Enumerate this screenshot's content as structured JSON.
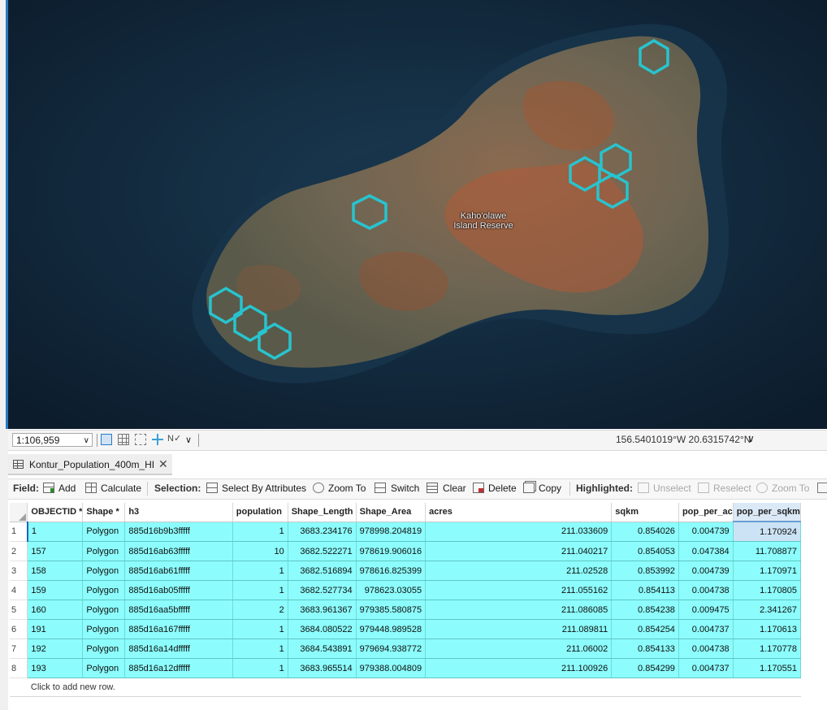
{
  "map": {
    "place_label_line1": "Kaho'olawe",
    "place_label_line2": "Island Reserve"
  },
  "statusbar": {
    "scale": "1:106,959",
    "coordinates": "156.5401019°W 20.6315742°N"
  },
  "tab": {
    "title": "Kontur_Population_400m_HI",
    "close_glyph": "✕"
  },
  "toolbar": {
    "field_label": "Field:",
    "add": "Add",
    "calculate": "Calculate",
    "selection_label": "Selection:",
    "select_by_attributes": "Select By Attributes",
    "zoom_to": "Zoom To",
    "switch": "Switch",
    "clear": "Clear",
    "delete": "Delete",
    "copy": "Copy",
    "highlighted_label": "Highlighted:",
    "unselect": "Unselect",
    "reselect": "Reselect",
    "zoom_to_2": "Zoom To"
  },
  "table": {
    "columns": [
      "OBJECTID *",
      "Shape *",
      "h3",
      "population",
      "Shape_Length",
      "Shape_Area",
      "acres",
      "sqkm",
      "pop_per_ac",
      "pop_per_sqkm"
    ],
    "rows": [
      {
        "row": "1",
        "objectid": "1",
        "shape": "Polygon",
        "h3": "885d16b9b3fffff",
        "population": "1",
        "shape_length": "3683.234176",
        "shape_area": "978998.204819",
        "acres": "211.033609",
        "sqkm": "0.854026",
        "pop_per_ac": "0.004739",
        "pop_per_sqkm": "1.170924"
      },
      {
        "row": "2",
        "objectid": "157",
        "shape": "Polygon",
        "h3": "885d16ab63fffff",
        "population": "10",
        "shape_length": "3682.522271",
        "shape_area": "978619.906016",
        "acres": "211.040217",
        "sqkm": "0.854053",
        "pop_per_ac": "0.047384",
        "pop_per_sqkm": "11.708877"
      },
      {
        "row": "3",
        "objectid": "158",
        "shape": "Polygon",
        "h3": "885d16ab61fffff",
        "population": "1",
        "shape_length": "3682.516894",
        "shape_area": "978616.825399",
        "acres": "211.02528",
        "sqkm": "0.853992",
        "pop_per_ac": "0.004739",
        "pop_per_sqkm": "1.170971"
      },
      {
        "row": "4",
        "objectid": "159",
        "shape": "Polygon",
        "h3": "885d16ab05fffff",
        "population": "1",
        "shape_length": "3682.527734",
        "shape_area": "978623.03055",
        "acres": "211.055162",
        "sqkm": "0.854113",
        "pop_per_ac": "0.004738",
        "pop_per_sqkm": "1.170805"
      },
      {
        "row": "5",
        "objectid": "160",
        "shape": "Polygon",
        "h3": "885d16aa5bfffff",
        "population": "2",
        "shape_length": "3683.961367",
        "shape_area": "979385.580875",
        "acres": "211.086085",
        "sqkm": "0.854238",
        "pop_per_ac": "0.009475",
        "pop_per_sqkm": "2.341267"
      },
      {
        "row": "6",
        "objectid": "191",
        "shape": "Polygon",
        "h3": "885d16a167fffff",
        "population": "1",
        "shape_length": "3684.080522",
        "shape_area": "979448.989528",
        "acres": "211.089811",
        "sqkm": "0.854254",
        "pop_per_ac": "0.004737",
        "pop_per_sqkm": "1.170613"
      },
      {
        "row": "7",
        "objectid": "192",
        "shape": "Polygon",
        "h3": "885d16a14dfffff",
        "population": "1",
        "shape_length": "3684.543891",
        "shape_area": "979694.938772",
        "acres": "211.06002",
        "sqkm": "0.854133",
        "pop_per_ac": "0.004738",
        "pop_per_sqkm": "1.170778"
      },
      {
        "row": "8",
        "objectid": "193",
        "shape": "Polygon",
        "h3": "885d16a12dfffff",
        "population": "1",
        "shape_length": "3683.965514",
        "shape_area": "979388.004809",
        "acres": "211.100926",
        "sqkm": "0.854299",
        "pop_per_ac": "0.004737",
        "pop_per_sqkm": "1.170551"
      }
    ],
    "add_row_text": "Click to add new row."
  },
  "colors": {
    "selected_row": "#8cfcfc",
    "hexagon_outline": "#27c4cf",
    "accent": "#1a66c2"
  },
  "icons": [
    "table-icon",
    "add-field-icon",
    "calculate-icon",
    "select-by-attributes-icon",
    "zoom-to-icon",
    "switch-icon",
    "clear-icon",
    "delete-icon",
    "copy-icon",
    "unselect-icon",
    "reselect-icon"
  ]
}
